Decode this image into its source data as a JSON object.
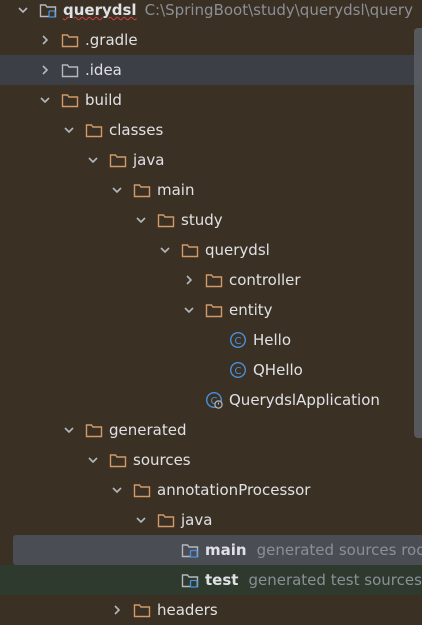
{
  "root": {
    "name": "querydsl",
    "path": "C:\\SpringBoot\\study\\querydsl\\query"
  },
  "items": [
    {
      "label": ".gradle"
    },
    {
      "label": ".idea"
    },
    {
      "label": "build"
    },
    {
      "label": "classes"
    },
    {
      "label": "java"
    },
    {
      "label": "main"
    },
    {
      "label": "study"
    },
    {
      "label": "querydsl"
    },
    {
      "label": "controller"
    },
    {
      "label": "entity"
    },
    {
      "label": "Hello"
    },
    {
      "label": "QHello"
    },
    {
      "label": "QuerydslApplication"
    },
    {
      "label": "generated"
    },
    {
      "label": "sources"
    },
    {
      "label": "annotationProcessor"
    },
    {
      "label": "java"
    },
    {
      "label": "main",
      "hint": "generated sources root"
    },
    {
      "label": "test",
      "hint": "generated test sources root"
    },
    {
      "label": "headers"
    }
  ],
  "colors": {
    "background": "#3b3024",
    "folder": "#d19a66",
    "class_icon": "#4a90d9",
    "text": "#dfe1e5",
    "hint": "#8b8f96"
  }
}
